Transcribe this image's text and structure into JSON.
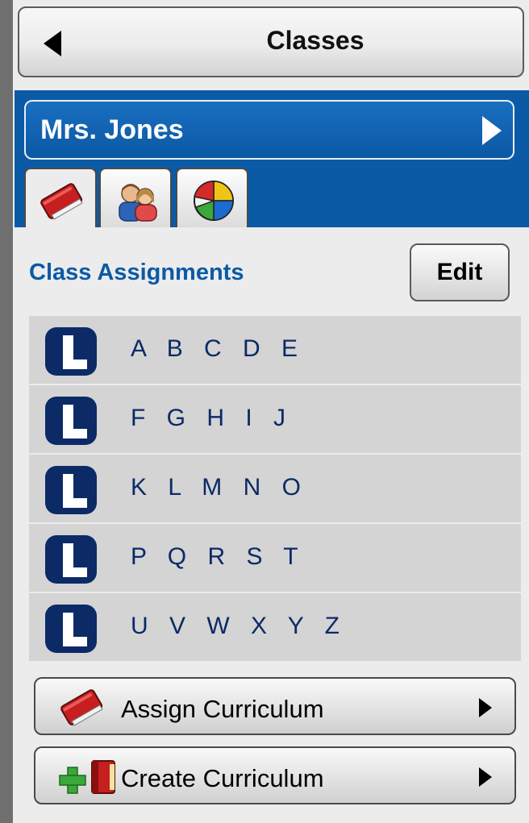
{
  "header": {
    "back_title": "Classes"
  },
  "teacher": {
    "name": "Mrs. Jones"
  },
  "tabs": [
    {
      "icon": "book-icon",
      "active": true
    },
    {
      "icon": "students-icon",
      "active": false
    },
    {
      "icon": "pie-chart-icon",
      "active": false
    }
  ],
  "assignments": {
    "title": "Class Assignments",
    "edit_label": "Edit",
    "items": [
      {
        "label": "A B C D E",
        "icon": "lesson-icon"
      },
      {
        "label": "F G H I J",
        "icon": "lesson-icon"
      },
      {
        "label": "K L M N O",
        "icon": "lesson-icon"
      },
      {
        "label": "P Q R S T",
        "icon": "lesson-icon"
      },
      {
        "label": "U V W X Y Z",
        "icon": "lesson-icon"
      }
    ]
  },
  "actions": {
    "assign_label": "Assign Curriculum",
    "create_label": "Create Curriculum"
  },
  "colors": {
    "panel_blue": "#0b5aa6",
    "lesson_navy": "#0b2a66",
    "background_gray": "#ececec"
  }
}
